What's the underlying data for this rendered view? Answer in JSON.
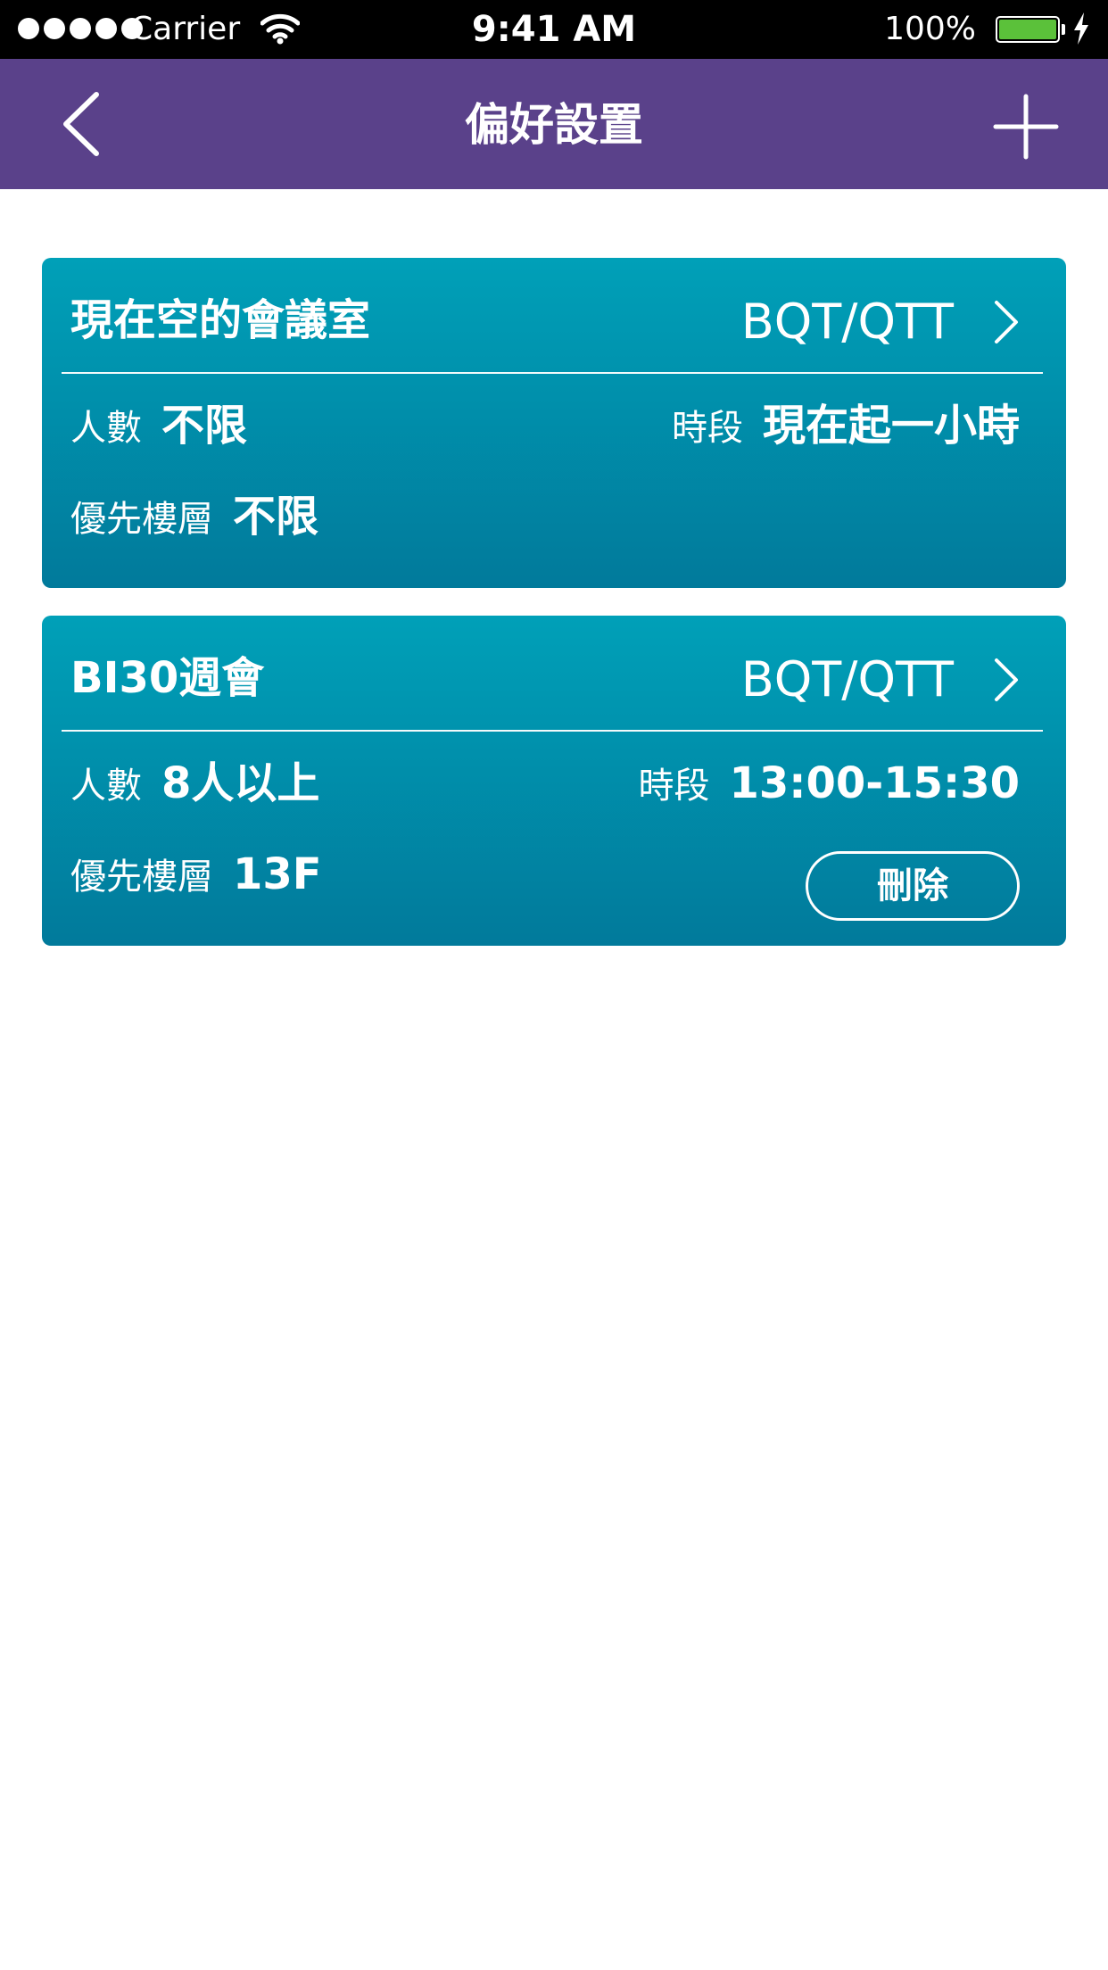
{
  "status_bar": {
    "carrier": "Carrier",
    "time": "9:41 AM",
    "battery_percent": "100%",
    "battery_level": 1.0,
    "battery_color": "#5bc13a",
    "signal_bars": 5
  },
  "nav": {
    "title": "偏好設置",
    "back_icon": "chevron-left-icon",
    "add_icon": "plus-icon",
    "background": "#5a418a"
  },
  "cards": [
    {
      "title": "現在空的會議室",
      "building": "BQT/QTT",
      "people_label": "人數",
      "people_value": "不限",
      "time_label": "時段",
      "time_value": "現在起一小時",
      "floor_label": "優先樓層",
      "floor_value": "不限"
    },
    {
      "title": "BI30週會",
      "building": "BQT/QTT",
      "people_label": "人數",
      "people_value": "8人以上",
      "time_label": "時段",
      "time_value": "13:00-15:30",
      "floor_label": "優先樓層",
      "floor_value": "13F",
      "delete_label": "刪除"
    }
  ],
  "colors": {
    "card_gradient_top": "#00a0b8",
    "card_gradient_bottom": "#017a9b"
  }
}
